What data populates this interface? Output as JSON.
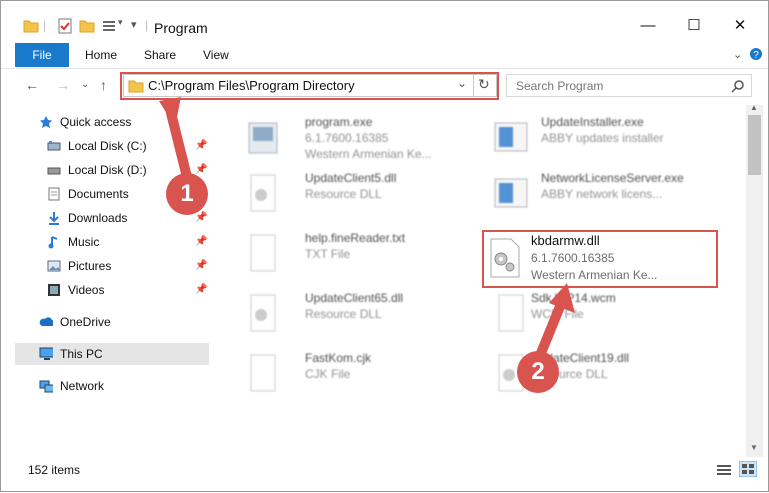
{
  "window": {
    "title": "Program",
    "minimize": "—",
    "maximize": "☐",
    "close": "✕"
  },
  "ribbon": {
    "file": "File",
    "home": "Home",
    "share": "Share",
    "view": "View"
  },
  "address": {
    "path": "C:\\Program Files\\Program Directory",
    "search_placeholder": "Search Program"
  },
  "sidebar": {
    "items": [
      {
        "label": "Quick access"
      },
      {
        "label": "Local Disk (C:)"
      },
      {
        "label": "Local Disk (D:)"
      },
      {
        "label": "Documents"
      },
      {
        "label": "Downloads"
      },
      {
        "label": "Music"
      },
      {
        "label": "Pictures"
      },
      {
        "label": "Videos"
      },
      {
        "label": "OneDrive"
      },
      {
        "label": "This PC"
      },
      {
        "label": "Network"
      }
    ]
  },
  "files": {
    "left": [
      {
        "name": "program.exe",
        "line1": "6.1.7600.16385",
        "line2": "Western Armenian Ke..."
      },
      {
        "name": "UpdateClient5.dll",
        "line1": "Resource DLL",
        "line2": ""
      },
      {
        "name": "help.fineReader.txt",
        "line1": "TXT File",
        "line2": ""
      },
      {
        "name": "UpdateClient65.dll",
        "line1": "Resource DLL",
        "line2": ""
      },
      {
        "name": "FastKom.cjk",
        "line1": "CJK File",
        "line2": ""
      }
    ],
    "right": [
      {
        "name": "UpdateInstaller.exe",
        "line1": "ABBY updates installer",
        "line2": ""
      },
      {
        "name": "NetworkLicenseServer.exe",
        "line1": "ABBY network licens...",
        "line2": ""
      },
      {
        "name": "kbdarmw.dll",
        "line1": "6.1.7600.16385",
        "line2": "Western Armenian Ke..."
      },
      {
        "name": "Sdk.WP14.wcm",
        "line1": "WCM File",
        "line2": ""
      },
      {
        "name": "UpdateClient19.dll",
        "line1": "Resource DLL",
        "line2": ""
      }
    ]
  },
  "annotations": {
    "step1": "1",
    "step2": "2",
    "color": "#d9534f"
  },
  "status": {
    "count": "152 items"
  }
}
